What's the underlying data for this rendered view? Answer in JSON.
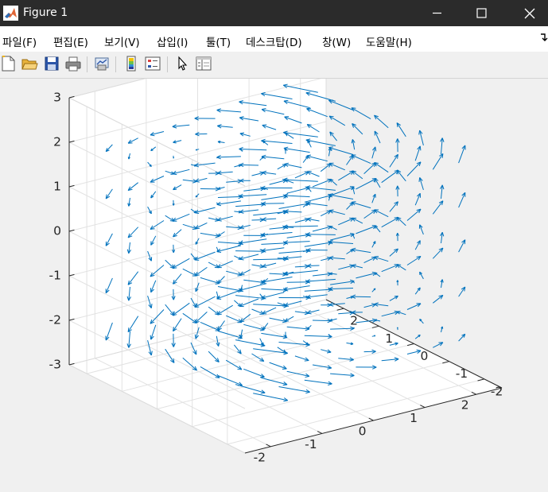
{
  "window": {
    "title": "Figure 1",
    "icons": [
      "matlab-logo-icon",
      "minimize-icon",
      "maximize-icon",
      "close-icon"
    ]
  },
  "menu": {
    "items": [
      "파일(F)",
      "편집(E)",
      "보기(V)",
      "삽입(I)",
      "툴(T)",
      "데스크탑(D)",
      "창(W)",
      "도움말(H)"
    ]
  },
  "toolbar": {
    "icons": [
      "new-figure-icon",
      "open-file-icon",
      "save-icon",
      "print-icon",
      "link-plot-icon",
      "insert-colorbar-icon",
      "insert-legend-icon",
      "edit-plot-icon",
      "property-inspector-icon"
    ]
  },
  "colors": {
    "titlebar": "#2b2b2b",
    "arrows": "#0072bd",
    "axes_background": "#ffffff",
    "figure_background": "#f0f0f0"
  },
  "chart_data": {
    "type": "quiver3",
    "title": "",
    "xlabel": "",
    "ylabel": "",
    "zlabel": "",
    "xlim": [
      -2.5,
      2.5
    ],
    "ylim": [
      -2.5,
      2.5
    ],
    "zlim": [
      -3,
      3
    ],
    "xticks": [
      "-2",
      "-1",
      "0",
      "1",
      "2"
    ],
    "yticks": [
      "-2",
      "-1",
      "0",
      "1",
      "2"
    ],
    "zticks": [
      "-3",
      "-2",
      "-1",
      "0",
      "1",
      "2",
      "3"
    ],
    "grid": true,
    "box": true,
    "view": "default 3-D (azimuth -37.5°, elevation 30°)",
    "grid_x": [
      -2,
      -1.5,
      -1,
      -0.5,
      0,
      0.5,
      1,
      1.5,
      2
    ],
    "grid_y": [
      -2,
      -1.5,
      -1,
      -0.5,
      0,
      0.5,
      1,
      1.5,
      2
    ],
    "grid_z": [
      -2,
      -1,
      0,
      1,
      2
    ],
    "vector_field": {
      "u": "-y",
      "v": "x",
      "w": "0.3*z"
    },
    "series": [
      {
        "color": "#0072bd"
      }
    ]
  }
}
